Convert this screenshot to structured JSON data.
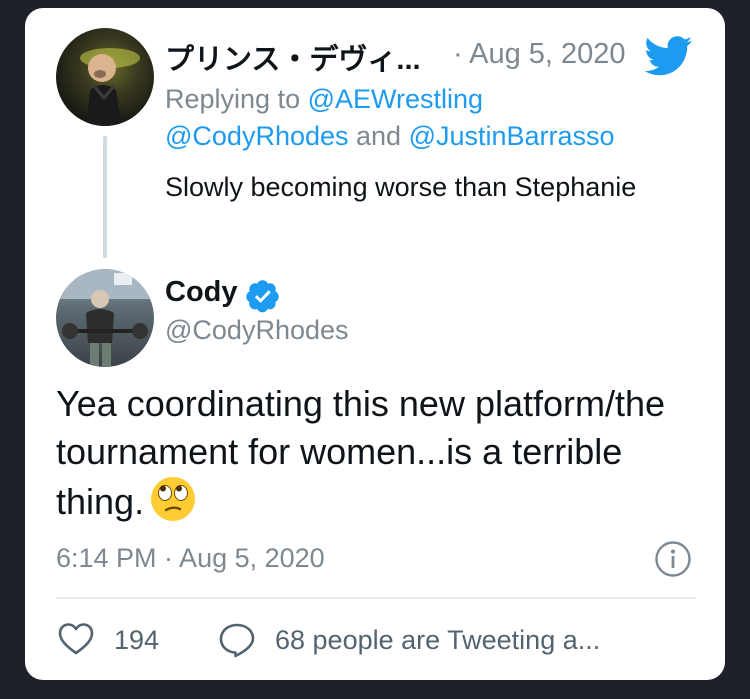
{
  "colors": {
    "background": "#1e2228",
    "card": "#ffffff",
    "text": "#0f1419",
    "muted": "#7d8890",
    "link": "#1d9bf0",
    "verified": "#1d9bf0"
  },
  "reply_tweet": {
    "author_name": "プリンス・デヴィ...",
    "date": "· Aug 5, 2020",
    "brand_icon": "twitter-bird-icon",
    "replying_to_prefix": "Replying to ",
    "replying_to_handle": "@AEWrestling",
    "mention_1": "@CodyRhodes",
    "mention_and": " and ",
    "mention_2": "@JustinBarrasso",
    "text": "Slowly becoming worse than Stephanie"
  },
  "main_tweet": {
    "author_name": "Cody",
    "verified_icon": "verified-badge-icon",
    "handle": "@CodyRhodes",
    "text": "Yea coordinating this new platform/the tournament for women...is a terrible thing.",
    "emoji": "face-with-rolling-eyes",
    "timestamp": "6:14 PM · Aug 5, 2020",
    "info_icon": "info-icon"
  },
  "engagement": {
    "like_icon": "heart-icon",
    "likes": "194",
    "reply_icon": "speech-bubble-icon",
    "tweeting": "68 people are Tweeting a..."
  }
}
